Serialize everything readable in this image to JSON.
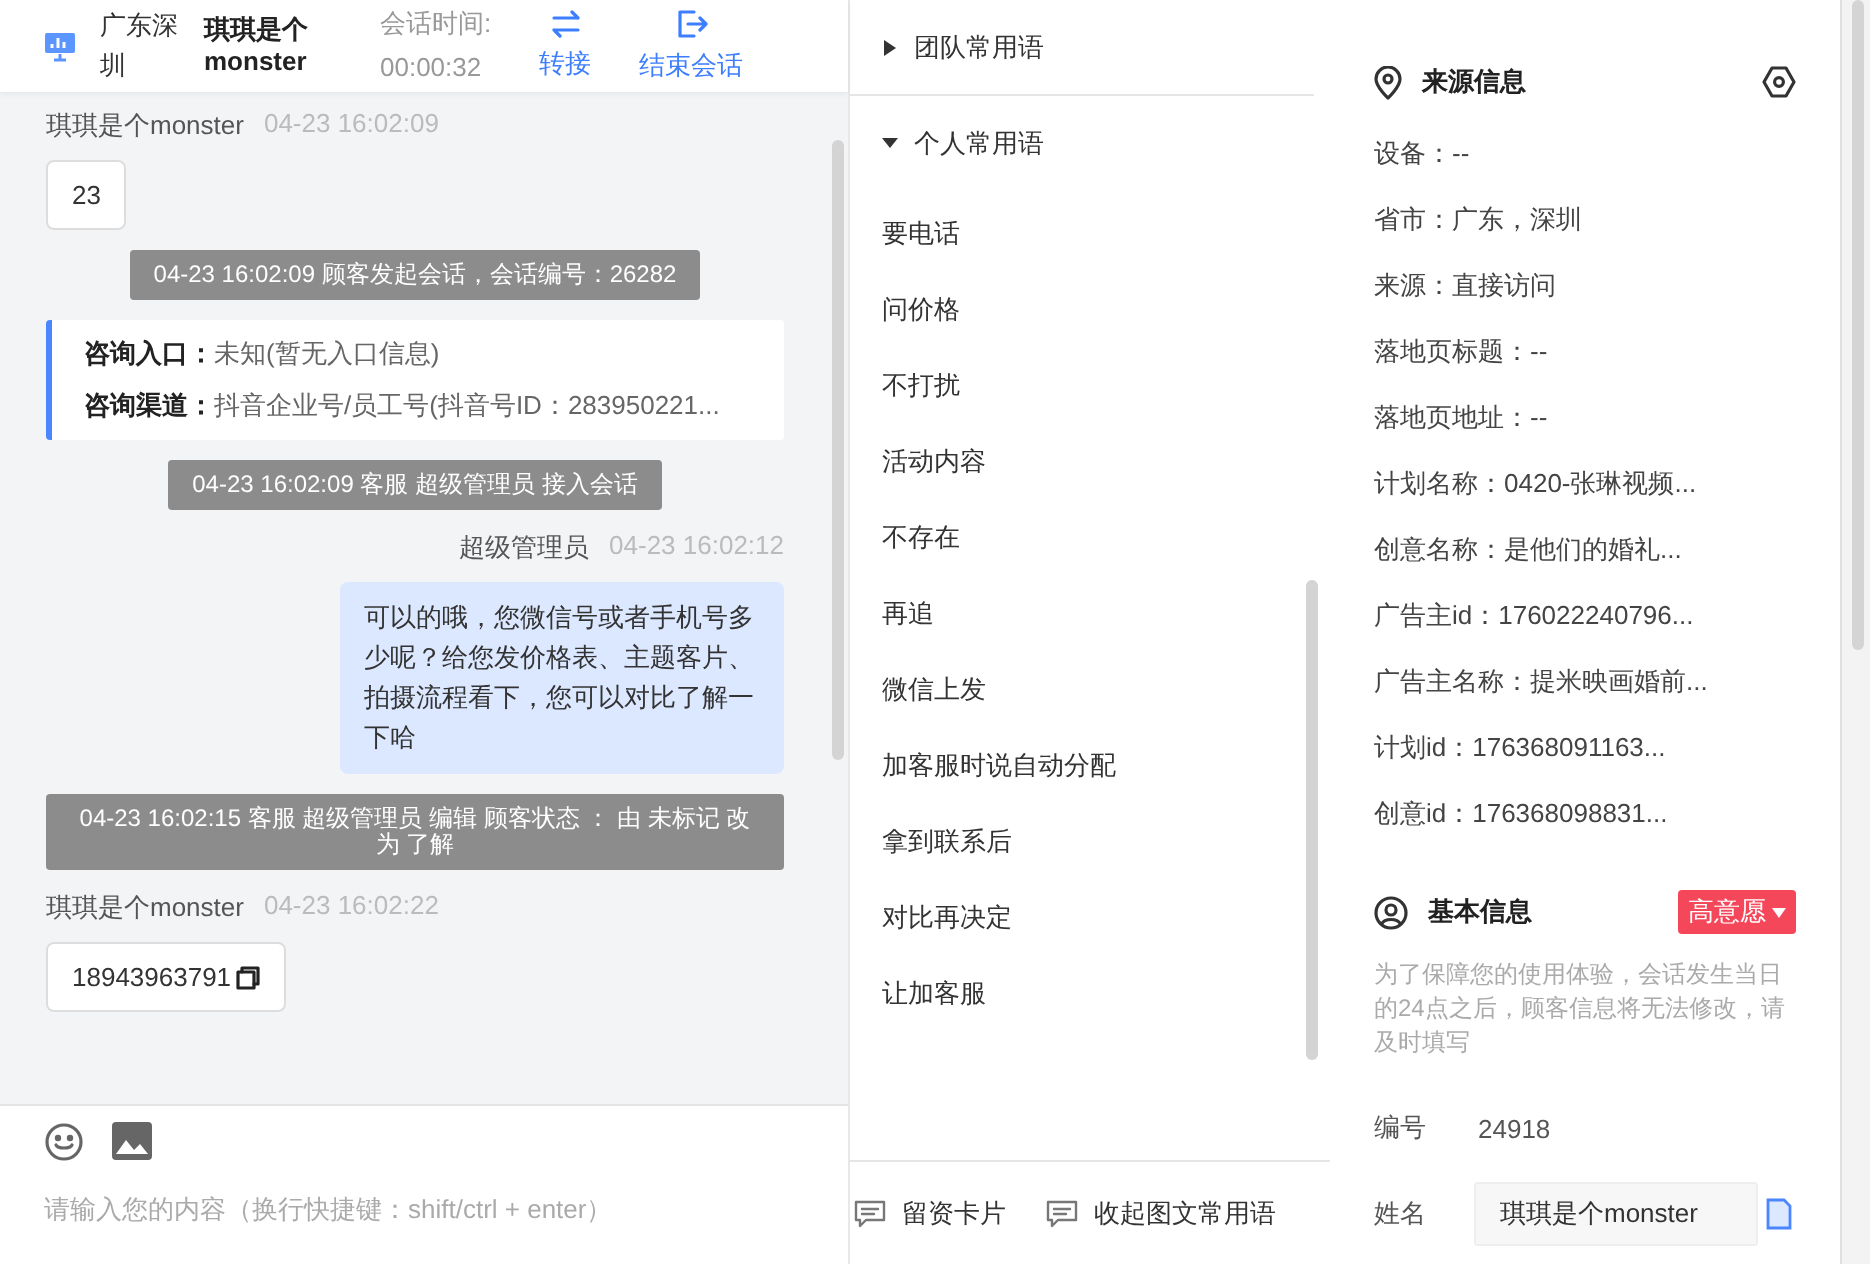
{
  "header": {
    "location": "广东深圳",
    "customer": "琪琪是个monster",
    "duration_label": "会话时间:",
    "duration": "00:00:32",
    "actions": [
      {
        "kind": "transfer",
        "label": "转接"
      },
      {
        "kind": "end",
        "label": "结束会话"
      }
    ]
  },
  "messages": [
    {
      "kind": "customer",
      "name": "琪琪是个monster",
      "time": "04-23 16:02:09",
      "text": "23"
    },
    {
      "kind": "system",
      "text": "04-23 16:02:09 顾客发起会话，会话编号：26282"
    },
    {
      "kind": "info",
      "rows": [
        {
          "label": "咨询入口：",
          "value": "未知(暂无入口信息)"
        },
        {
          "label": "咨询渠道：",
          "value": "抖音企业号/员工号(抖音号ID：283950221..."
        }
      ]
    },
    {
      "kind": "system",
      "text": "04-23 16:02:09 客服 超级管理员 接入会话"
    },
    {
      "kind": "agent",
      "name": "超级管理员",
      "time": "04-23 16:02:12",
      "text": "可以的哦，您微信号或者手机号多少呢？给您发价格表、主题客片、拍摄流程看下，您可以对比了解一下哈"
    },
    {
      "kind": "system",
      "text": "04-23 16:02:15 客服 超级管理员 编辑 顾客状态 ： 由 未标记 改为 了解"
    },
    {
      "kind": "customer",
      "name": "琪琪是个monster",
      "time": "04-23 16:02:22",
      "text": "18943963791",
      "copy": true
    }
  ],
  "composer": {
    "placeholder": "请输入您的内容（换行快捷键：shift/ctrl + enter）"
  },
  "phrases": {
    "groups": [
      {
        "title": "团队常用语",
        "expanded": false
      },
      {
        "title": "个人常用语",
        "expanded": true,
        "items": [
          "要电话",
          "问价格",
          "不打扰",
          "活动内容",
          "不存在",
          "再追",
          "微信上发",
          "加客服时说自动分配",
          "拿到联系后",
          "对比再决定",
          "让加客服"
        ]
      }
    ],
    "tools": [
      "留资卡片",
      "收起图文常用语"
    ]
  },
  "source": {
    "title": "来源信息",
    "fields": [
      "设备：--",
      "省市：广东，深圳",
      "来源：直接访问",
      "落地页标题：--",
      "落地页地址：--",
      "计划名称：0420-张琳视频...",
      "创意名称：是他们的婚礼...",
      "广告主id：176022240796...",
      "广告主名称：提米映画婚前...",
      "计划id：176368091163...",
      "创意id：176368098831..."
    ]
  },
  "basic": {
    "title": "基本信息",
    "tag": {
      "label": "高意愿",
      "color": "#f5475a"
    },
    "note": "为了保障您的使用体验，会话发生当日的24点之后，顾客信息将无法修改，请及时填写",
    "number_label": "编号",
    "number": "24918",
    "name_label": "姓名",
    "name": "琪琪是个monster"
  }
}
